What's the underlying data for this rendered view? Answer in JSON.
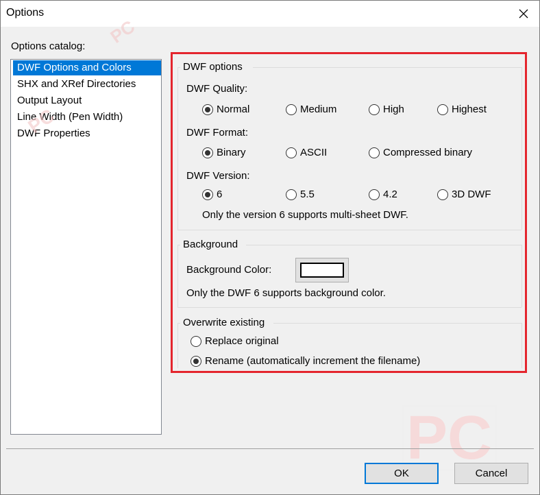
{
  "window": {
    "title": "Options"
  },
  "catalog": {
    "label": "Options catalog:",
    "items": [
      "DWF Options and Colors",
      "SHX and XRef Directories",
      "Output Layout",
      "Line Width (Pen Width)",
      "DWF Properties"
    ],
    "selected_index": 0
  },
  "dwf_options": {
    "group_label": "DWF options",
    "quality": {
      "label": "DWF Quality:",
      "options": [
        "Normal",
        "Medium",
        "High",
        "Highest"
      ],
      "selected": "Normal"
    },
    "format": {
      "label": "DWF Format:",
      "options": [
        "Binary",
        "ASCII",
        "Compressed binary"
      ],
      "selected": "Binary"
    },
    "version": {
      "label": "DWF Version:",
      "options": [
        "6",
        "5.5",
        "4.2",
        "3D DWF"
      ],
      "selected": "6",
      "note": "Only the version 6 supports multi-sheet DWF."
    }
  },
  "background": {
    "group_label": "Background",
    "color_label": "Background Color:",
    "color_value": "#ffffff",
    "note": "Only the DWF 6 supports background color."
  },
  "overwrite": {
    "group_label": "Overwrite existing",
    "options": [
      "Replace original",
      "Rename (automatically increment the filename)"
    ],
    "selected": "Rename (automatically increment the filename)"
  },
  "buttons": {
    "ok": "OK",
    "cancel": "Cancel"
  },
  "watermark": {
    "text": "PC"
  },
  "colors": {
    "selection": "#0078d7",
    "highlight_box": "#e4252d"
  }
}
